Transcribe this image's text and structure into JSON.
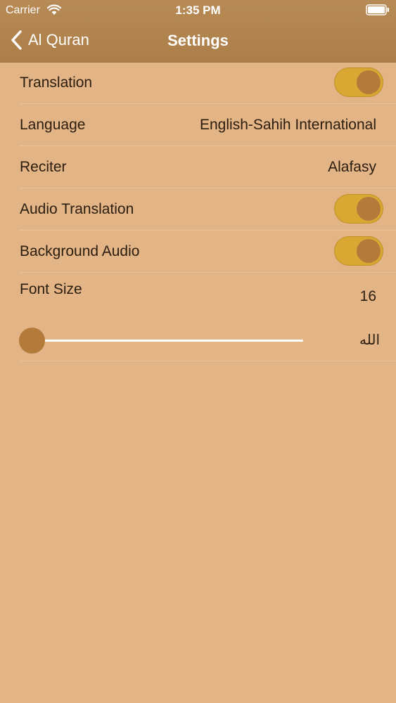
{
  "status_bar": {
    "carrier": "Carrier",
    "time": "1:35 PM",
    "wifi_icon": "wifi-icon",
    "battery_icon": "battery-icon"
  },
  "nav": {
    "back_label": "Al Quran",
    "back_icon": "chevron-left-icon",
    "title": "Settings"
  },
  "settings": {
    "translation": {
      "label": "Translation",
      "enabled": true
    },
    "language": {
      "label": "Language",
      "value": "English-Sahih International"
    },
    "reciter": {
      "label": "Reciter",
      "value": "Alafasy"
    },
    "audio_translation": {
      "label": "Audio Translation",
      "enabled": true
    },
    "background_audio": {
      "label": "Background Audio",
      "enabled": true
    },
    "font_size": {
      "label": "Font Size",
      "value": "16",
      "slider_level": 0.0,
      "sample_text": "الله"
    }
  },
  "colors": {
    "background": "#e2b486",
    "nav_bar": "#b0834c",
    "toggle_on": "#d8a832",
    "toggle_knob": "#b47a3a",
    "slider_thumb": "#b47a3a",
    "text": "#2b1d10"
  }
}
